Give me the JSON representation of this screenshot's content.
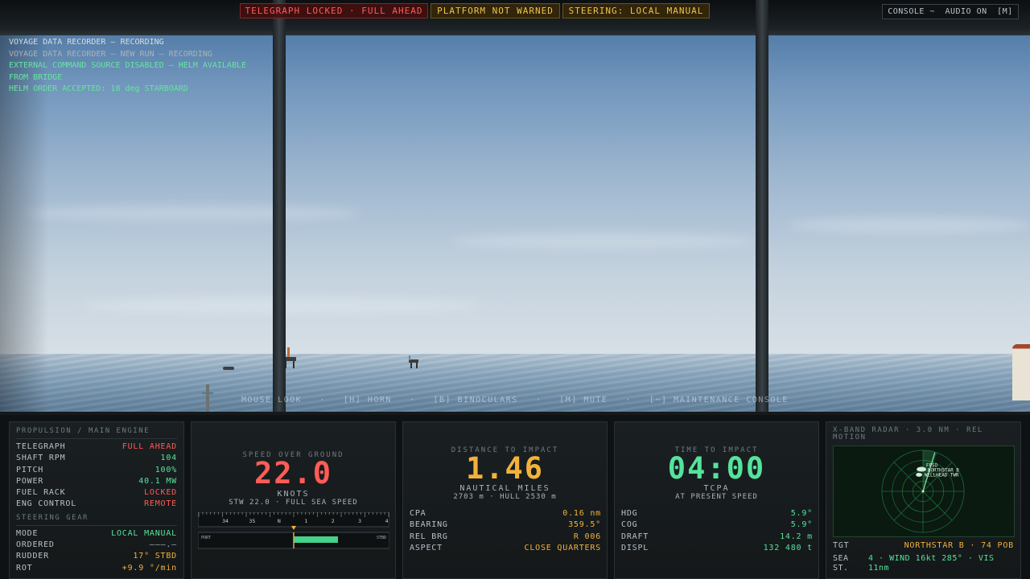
{
  "badges": {
    "telegraph": "TELEGRAPH LOCKED · FULL AHEAD",
    "platform": "PLATFORM NOT WARNED",
    "steering": "STEERING: LOCAL MANUAL"
  },
  "console": {
    "label": "CONSOLE ~",
    "audio": "AUDIO ON",
    "audio_key": "[M]"
  },
  "log": [
    {
      "text": "VOYAGE DATA RECORDER — RECORDING",
      "tone": "white"
    },
    {
      "text": "VOYAGE DATA RECORDER — NEW RUN — RECORDING",
      "tone": "grey"
    },
    {
      "text": "EXTERNAL COMMAND SOURCE DISABLED — HELM AVAILABLE FROM BRIDGE",
      "tone": "green"
    },
    {
      "text": "HELM ORDER ACCEPTED: 18 deg STARBOARD",
      "tone": "green"
    }
  ],
  "hotkeys": [
    "MOUSE LOOK",
    "·",
    "[H] HORN",
    "·",
    "[B] BINOCULARS",
    "·",
    "[M] MUTE",
    "·",
    "[~] MAINTENANCE CONSOLE"
  ],
  "propulsion": {
    "title": "PROPULSION / MAIN ENGINE",
    "rows": [
      {
        "k": "TELEGRAPH",
        "v": "FULL AHEAD",
        "c": "red"
      },
      {
        "k": "SHAFT RPM",
        "v": "104",
        "c": "green"
      },
      {
        "k": "PITCH",
        "v": "100%",
        "c": "green"
      },
      {
        "k": "POWER",
        "v": "40.1 MW",
        "c": "green"
      },
      {
        "k": "FUEL RACK",
        "v": "LOCKED",
        "c": "red"
      },
      {
        "k": "ENG CONTROL",
        "v": "REMOTE",
        "c": "red"
      }
    ],
    "steering_title": "STEERING GEAR",
    "steering_rows": [
      {
        "k": "MODE",
        "v": "LOCAL MANUAL",
        "c": "green"
      },
      {
        "k": "ORDERED",
        "v": "———.—",
        "c": "grey"
      },
      {
        "k": "RUDDER",
        "v": "17° STBD",
        "c": "amber"
      },
      {
        "k": "ROT",
        "v": "+9.9 °/min",
        "c": "amber"
      }
    ]
  },
  "speed": {
    "caption": "SPEED OVER GROUND",
    "value": "22.0",
    "unit": "KNOTS",
    "sub": "STW 22.0 · FULL SEA SPEED",
    "heading_ticks": [
      "34",
      "35",
      "N",
      "1",
      "2",
      "3",
      "4"
    ],
    "port_label": "PORT",
    "stbd_label": "STBD",
    "rudder_fraction": 0.47
  },
  "distance": {
    "caption": "DISTANCE TO IMPACT",
    "value": "1.46",
    "unit": "NAUTICAL MILES",
    "sub": "2703 m · HULL 2530 m",
    "rows": [
      {
        "k": "CPA",
        "v": "0.16 nm",
        "c": "amber"
      },
      {
        "k": "BEARING",
        "v": "359.5°",
        "c": "amber"
      },
      {
        "k": "REL BRG",
        "v": "R 006",
        "c": "amber"
      },
      {
        "k": "ASPECT",
        "v": "CLOSE QUARTERS",
        "c": "amber"
      }
    ]
  },
  "time": {
    "caption": "TIME TO IMPACT",
    "value": "04:00",
    "unit": "TCPA",
    "sub": "AT PRESENT SPEED",
    "rows": [
      {
        "k": "HDG",
        "v": "5.9°",
        "c": "green"
      },
      {
        "k": "COG",
        "v": "5.9°",
        "c": "green"
      },
      {
        "k": "DRAFT",
        "v": "14.2 m",
        "c": "green"
      },
      {
        "k": "DISPL",
        "v": "132 480 t",
        "c": "green"
      }
    ]
  },
  "radar": {
    "title": "X-BAND RADAR · 3.0 NM · REL MOTION",
    "contact_label_1": "NORTHSTAR B",
    "contact_label_2": "WELLHEAD TWR",
    "contact_label_3": "FPSO",
    "tgt_key": "TGT",
    "tgt_val": "NORTHSTAR B · 74 POB",
    "sea_key": "SEA ST.",
    "sea_val": "4 · WIND 16kt 285° · VIS 11nm"
  }
}
